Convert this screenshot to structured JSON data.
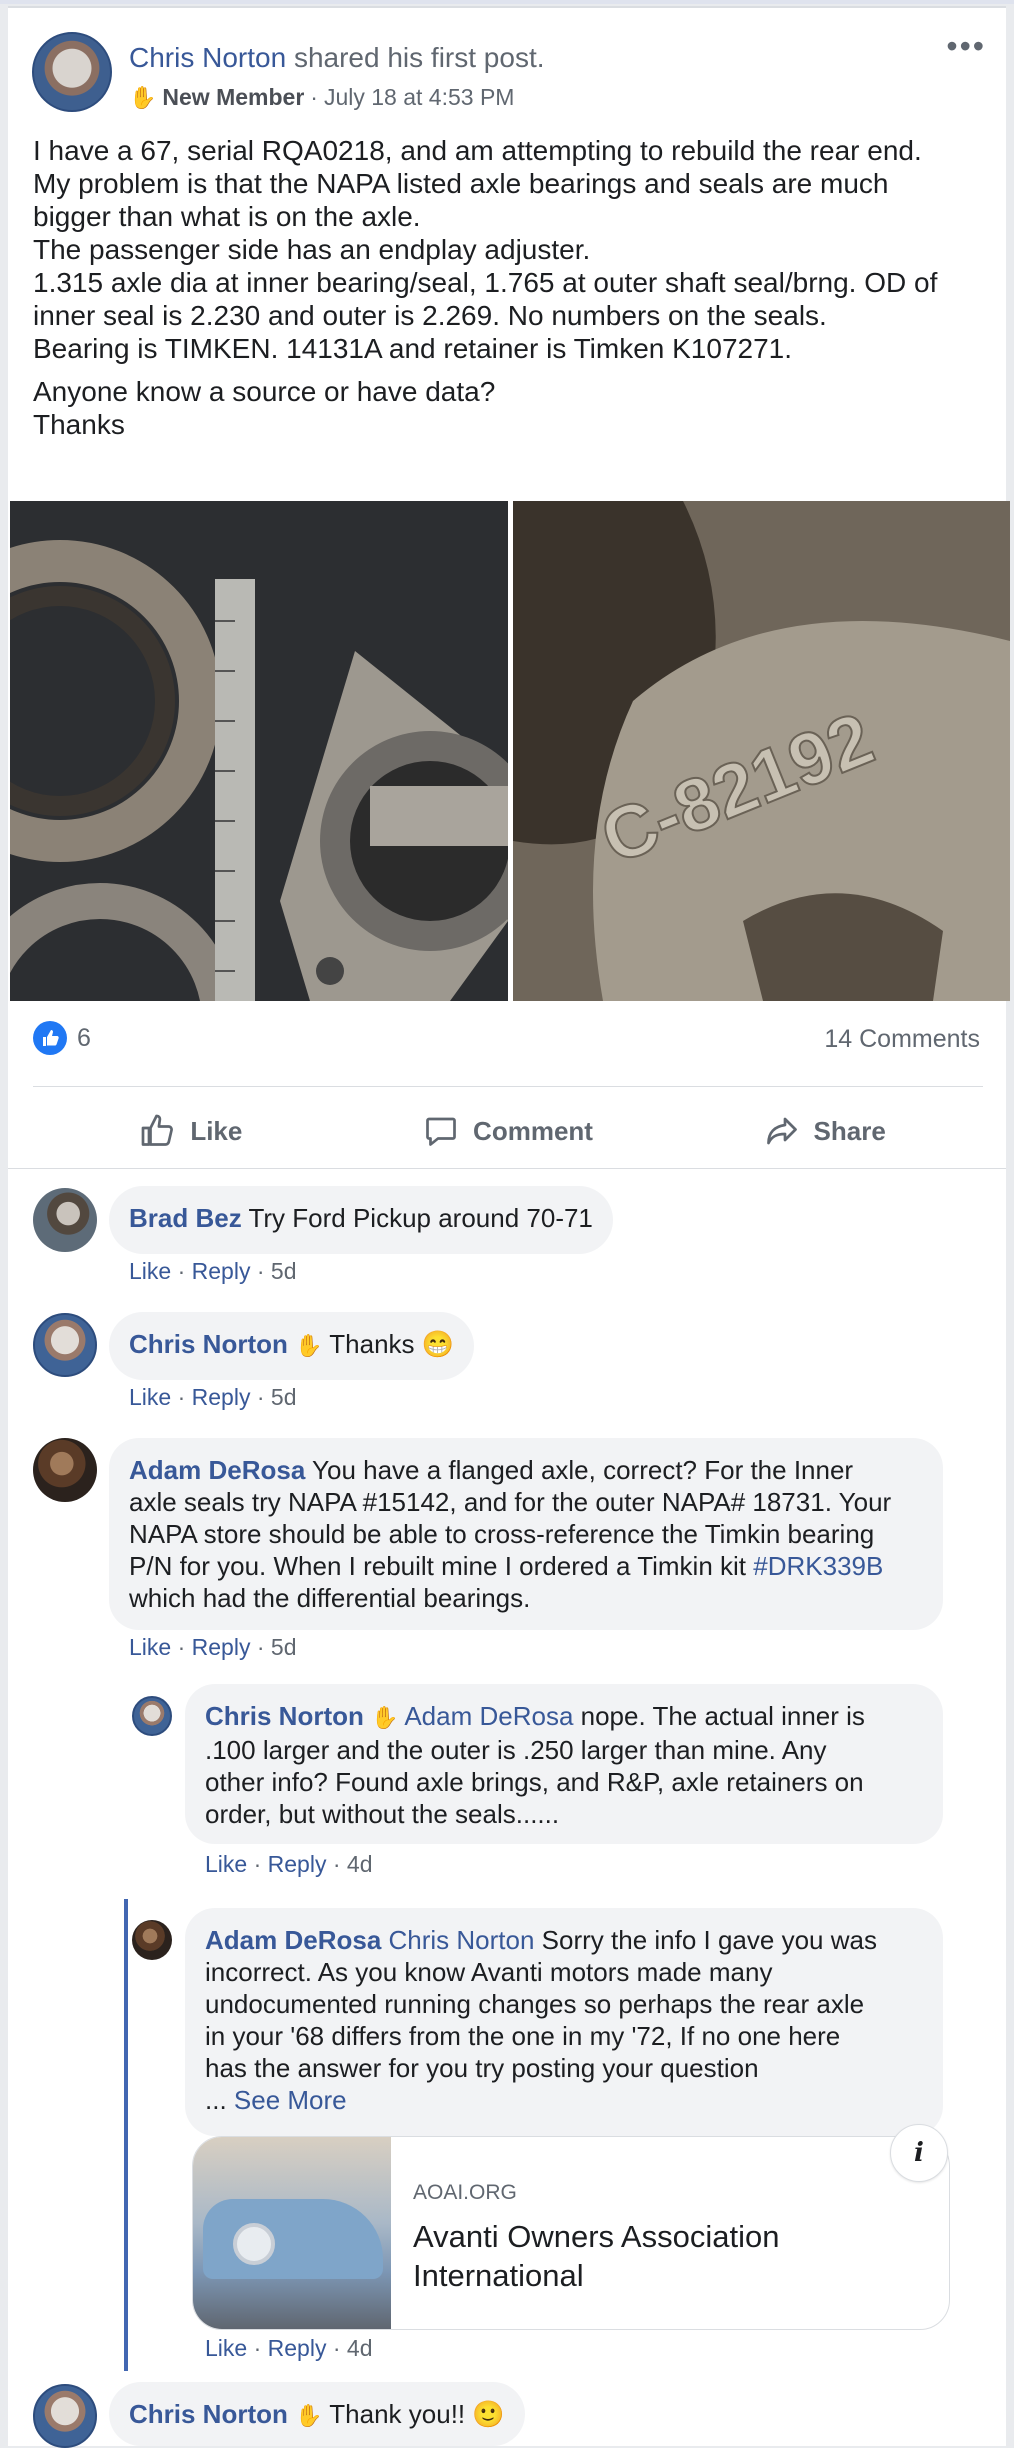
{
  "post": {
    "author": "Chris Norton",
    "action": "shared his first post.",
    "badge": "New Member",
    "sep": "·",
    "time": "July 18 at 4:53 PM",
    "text_lines": [
      "I have a 67, serial RQA0218, and am attempting to rebuild the rear end.",
      "My problem is that the NAPA listed axle bearings and seals are much",
      "bigger than what is on the axle.",
      "The passenger side has an endplay adjuster.",
      "1.315 axle dia at inner bearing/seal, 1.765 at outer shaft seal/brng. OD of",
      "inner seal is 2.230 and outer is 2.269. No numbers on the seals.",
      "Bearing is TIMKEN. 14131A and retainer is Timken K107271."
    ],
    "text_lines2": [
      "Anyone know a source or have data?",
      "Thanks"
    ],
    "photo_right_text": "C-82192"
  },
  "reactions": {
    "likes": "6",
    "comments": "14 Comments"
  },
  "actions": {
    "like": "Like",
    "comment": "Comment",
    "share": "Share"
  },
  "comments": [
    {
      "author": "Brad Bez",
      "text": "Try Ford Pickup around 70-71",
      "like": "Like",
      "reply": "Reply",
      "time": "5d"
    },
    {
      "author": "Chris Norton",
      "text": "Thanks 😁",
      "like": "Like",
      "reply": "Reply",
      "time": "5d"
    },
    {
      "author": "Adam DeRosa",
      "lines": [
        " You have a flanged axle, correct? For the Inner",
        "axle seals try NAPA #15142, and for the outer NAPA# 18731. Your",
        "NAPA store should be able to cross-reference the Timkin bearing",
        "P/N for you. When I rebuilt mine I ordered a Timkin kit "
      ],
      "hashtag": "#DRK339B",
      "last": "which had the differential bearings.",
      "like": "Like",
      "reply": "Reply",
      "time": "5d"
    },
    {
      "author": "Chris Norton",
      "mention": "Adam DeRosa",
      "lines": [
        " nope. The actual inner is",
        ".100 larger and the outer is .250 larger than mine. Any",
        "other info? Found axle brings, and R&P, axle retainers on",
        "order, but without the seals......"
      ],
      "like": "Like",
      "reply": "Reply",
      "time": "4d"
    },
    {
      "author": "Adam DeRosa",
      "mention": "Chris Norton",
      "lines": [
        " Sorry the info I gave you was",
        "incorrect. As you know Avanti motors made many",
        "undocumented running changes so perhaps the rear axle",
        "in your '68 differs from the one in my '72, If no one here",
        "has the answer for you try posting your question"
      ],
      "see_more_prefix": "... ",
      "see_more": "See More",
      "link": {
        "domain": "AOAI.ORG",
        "title": "Avanti Owners Association International"
      },
      "like": "Like",
      "reply": "Reply",
      "time": "4d"
    },
    {
      "author": "Chris Norton",
      "text": "Thank you!! 🙂"
    }
  ],
  "colors": {
    "link": "#385898",
    "accent": "#4267b2",
    "like": "#2078f4"
  }
}
